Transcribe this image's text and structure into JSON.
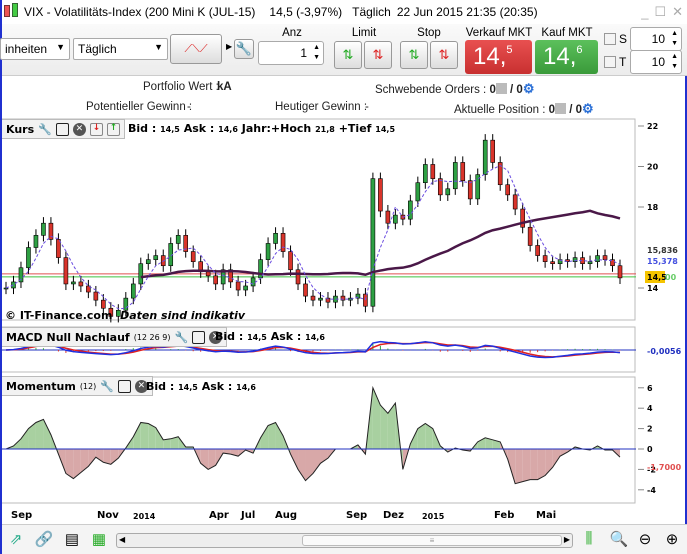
{
  "window": {
    "title": "VIX - Volatilitäts-Index (200 Mini K (JUL-15)",
    "price": "14,5 (-3,97%)",
    "period": "Täglich",
    "datetime": "22 Jun 2015 21:35 (20:35)"
  },
  "toolbar": {
    "units_select": "inheiten",
    "period_select": "Täglich",
    "anz_label": "Anz",
    "anz_value": "1",
    "limit_label": "Limit",
    "stop_label": "Stop",
    "sell_label": "Verkauf MKT",
    "buy_label": "Kauf MKT",
    "sell_price_main": "14,",
    "sell_price_sup": "5",
    "buy_price_main": "14,",
    "buy_price_sup": "6",
    "s_label": "S",
    "t_label": "T",
    "s_value": "10",
    "t_value": "10"
  },
  "info": {
    "portfolio_label": "Portfolio Wert :",
    "portfolio_value": "kA",
    "pending_label": "Schwebende Orders :",
    "pending_a": "0",
    "pending_b": "/ 0",
    "potential_label": "Potentieller Gewinn :",
    "potential_value": "-",
    "today_label": "Heutiger Gewinn :",
    "today_value": "-",
    "position_label": "Aktuelle Position :",
    "position_a": "0",
    "position_b": "/ 0"
  },
  "kurs": {
    "title": "Kurs",
    "bid_label": "Bid :",
    "bid": "14,5",
    "ask_label": "Ask :",
    "ask": "14,6",
    "year_high_label": "Jahr:+Hoch",
    "year_high": "21,8",
    "year_low_label": "+Tief",
    "year_low": "14,5",
    "copyright": "© IT-Finance.com",
    "disclaimer": "Daten sind indikativ"
  },
  "macd": {
    "title": "MACD Null Nachlauf",
    "params": "(12 26 9)",
    "bid_label": "Bid :",
    "bid": "14,5",
    "ask_label": "Ask :",
    "ask": "14,6",
    "value": "-0,0056"
  },
  "momentum": {
    "title": "Momentum",
    "params": "(12)",
    "bid_label": "Bid :",
    "bid": "14,5",
    "ask_label": "Ask :",
    "ask": "14,6",
    "value": "-1,7000"
  },
  "chart_data": {
    "type": "candlestick",
    "x_labels": [
      "Sep",
      "Nov",
      "2014",
      "Apr",
      "Jul",
      "Aug",
      "Sep",
      "Dez",
      "2015",
      "Feb",
      "Mai"
    ],
    "price_axis": {
      "ticks": [
        "22",
        "20",
        "18",
        "14"
      ],
      "range": [
        12,
        22.3
      ]
    },
    "ma_labels": {
      "ma200": "15,836",
      "ma_short": "15,378",
      "last": "14,5",
      "last_suffix": "00"
    },
    "momentum_axis": {
      "ticks": [
        "6",
        "4",
        "2",
        "0",
        "-2",
        "-4"
      ]
    },
    "closes": [
      14,
      14.3,
      15,
      16,
      16.6,
      17.2,
      16.4,
      15.5,
      14.2,
      14.3,
      14.1,
      13.8,
      13.4,
      13,
      12.6,
      12.9,
      13.5,
      14.2,
      15.2,
      15.4,
      15.6,
      15.1,
      16.2,
      16.6,
      15.8,
      15.3,
      14.8,
      14.6,
      14.2,
      14.9,
      14.3,
      13.9,
      14.1,
      14.5,
      15.4,
      16.2,
      16.7,
      15.8,
      14.9,
      14.2,
      13.6,
      13.4,
      13.5,
      13.3,
      13.6,
      13.4,
      13.5,
      13.7,
      13.1,
      19.4,
      17.8,
      17.2,
      17.6,
      17.4,
      18.3,
      19.2,
      20.1,
      19.4,
      18.6,
      18.9,
      20.2,
      19.3,
      18.4,
      19.6,
      21.3,
      20.2,
      19.1,
      18.6,
      17.9,
      17.0,
      16.1,
      15.6,
      15.3,
      15.2,
      15.4,
      15.3,
      15.5,
      15.2,
      15.3,
      15.6,
      15.4,
      15.1,
      14.5
    ],
    "colors": {
      "up": "#2ea043",
      "down": "#d9342b",
      "ma200": "#4a1848",
      "ma_short": "#6b4de0",
      "macd": "#1f2fe0",
      "signal": "#e02020",
      "mom_pos": "#a8d0a0",
      "mom_neg": "#d8a8a8"
    }
  }
}
